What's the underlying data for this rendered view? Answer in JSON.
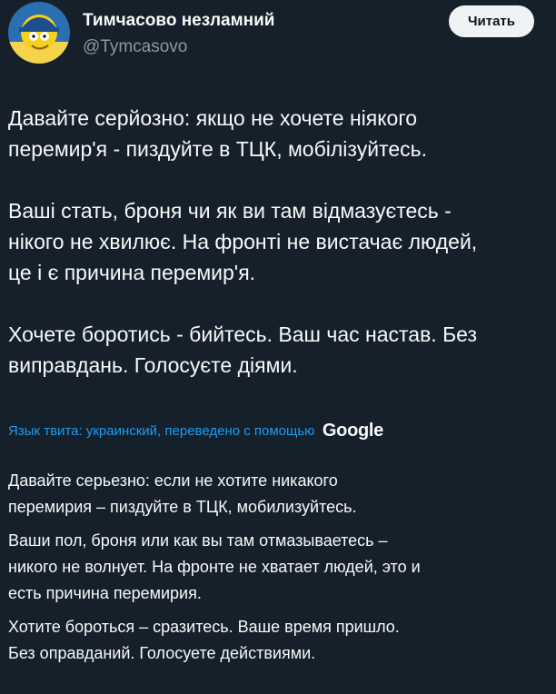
{
  "author": {
    "name": "Тимчасово незламний",
    "handle": "@Tymcasovo",
    "follow_label": "Читать"
  },
  "tweet": {
    "original_paragraphs": [
      [
        "Давайте серйозно: якщо не хочете ніякого",
        "перемир'я - пиздуйте в ТЦК, мобілізуйтесь."
      ],
      [
        "Ваші стать, броня чи як ви там відмазуєтесь -",
        "нікого не хвилює. На фронті не вистачає людей,",
        "це і є причина перемир'я."
      ],
      [
        "Хочете боротись - бийтесь. Ваш час настав. Без",
        "виправдань. Голосуєте діями."
      ]
    ],
    "translation_label": "Язык твита: украинский, переведено с помощью",
    "translation_provider": "Google",
    "translated_paragraphs": [
      [
        "Давайте серьезно: если не хотите никакого",
        "перемирия – пиздуйте в ТЦК, мобилизуйтесь."
      ],
      [
        "Ваши пол, броня или как вы там отмазываетесь –",
        "никого не волнует. На фронте не хватает людей, это и",
        "есть причина перемирия."
      ],
      [
        "Хотите бороться – сразитесь. Ваше время пришло.",
        "Без оправданий. Голосуете действиями."
      ]
    ]
  },
  "colors": {
    "background": "#15202b",
    "text": "#f7f9f9",
    "secondary_text": "#8b98a5",
    "link": "#1d9bf0",
    "button_bg": "#eff3f4"
  },
  "icons": {
    "avatar": "cartoon-avatar-icon"
  }
}
